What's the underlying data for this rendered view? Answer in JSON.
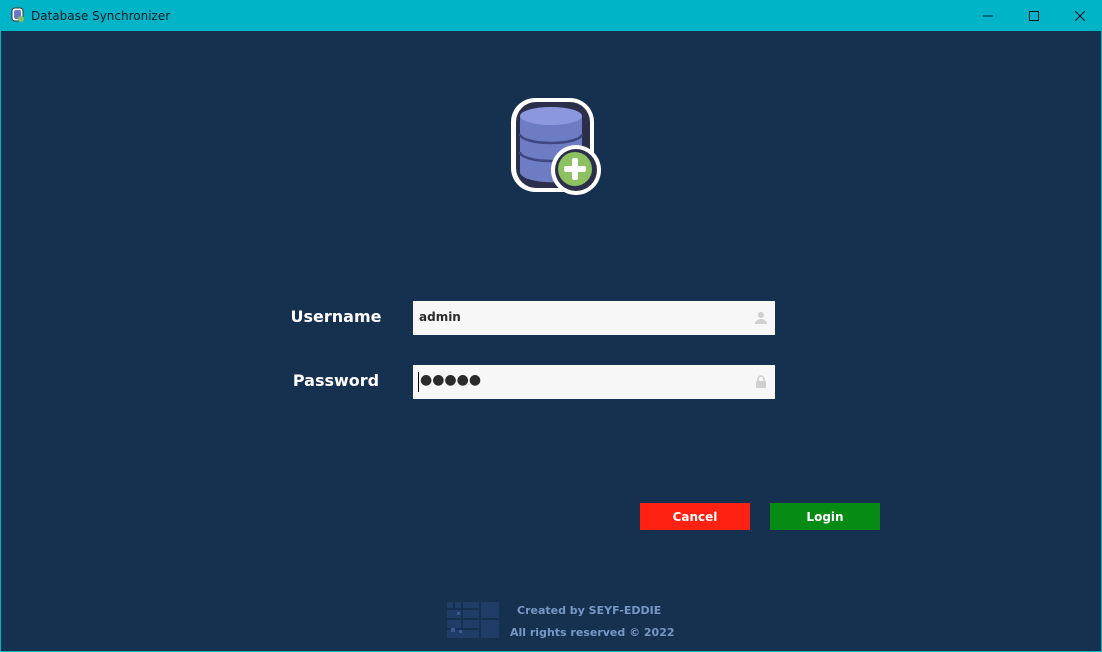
{
  "window": {
    "title": "Database Synchronizer",
    "controls": {
      "minimize": "minimize",
      "maximize": "maximize",
      "close": "close"
    }
  },
  "form": {
    "username": {
      "label": "Username",
      "value": "admin",
      "icon": "user-icon"
    },
    "password": {
      "label": "Password",
      "masked_value": "●●●●●",
      "icon": "lock-icon"
    }
  },
  "buttons": {
    "cancel": "Cancel",
    "login": "Login"
  },
  "footer": {
    "credit": "Created by SEYF-EDDIE",
    "rights": "All rights reserved © 2022"
  },
  "colors": {
    "titlebar": "#00b4c8",
    "background": "#163050",
    "cancel": "#ff2212",
    "login": "#068c14",
    "footer_text": "#7898c4"
  }
}
